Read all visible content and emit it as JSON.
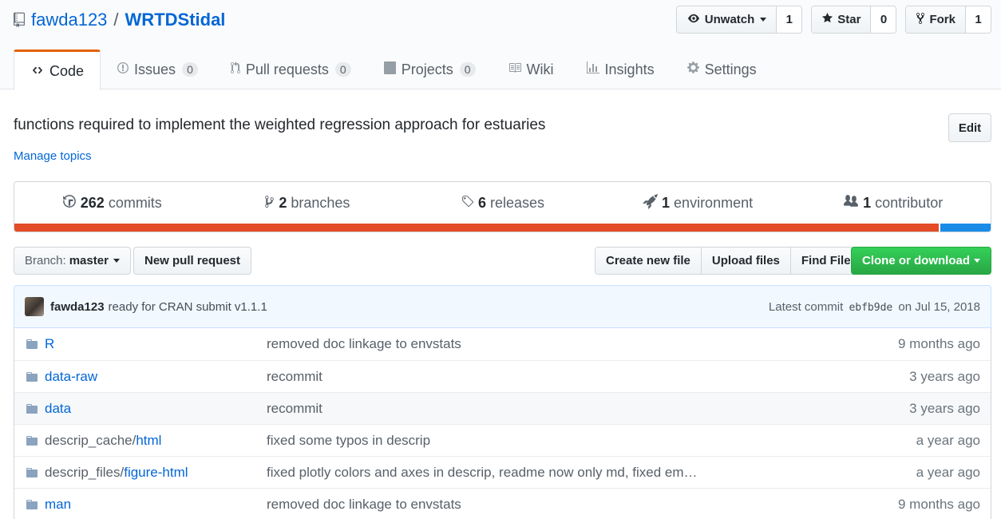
{
  "repo": {
    "owner": "fawda123",
    "separator": "/",
    "name": "WRTDStidal"
  },
  "actions": {
    "watch": {
      "label": "Unwatch",
      "count": "1"
    },
    "star": {
      "label": "Star",
      "count": "0"
    },
    "fork": {
      "label": "Fork",
      "count": "1"
    }
  },
  "tabs": [
    {
      "label": "Code",
      "icon": "code-icon",
      "selected": true
    },
    {
      "label": "Issues",
      "count": "0",
      "icon": "issue-icon"
    },
    {
      "label": "Pull requests",
      "count": "0",
      "icon": "pull-request-icon"
    },
    {
      "label": "Projects",
      "count": "0",
      "icon": "project-icon"
    },
    {
      "label": "Wiki",
      "icon": "book-icon"
    },
    {
      "label": "Insights",
      "icon": "graph-icon"
    },
    {
      "label": "Settings",
      "icon": "gear-icon"
    }
  ],
  "description": "functions required to implement the weighted regression approach for estuaries",
  "edit_label": "Edit",
  "manage_topics": "Manage topics",
  "summary": {
    "commits": {
      "count": "262",
      "label": "commits"
    },
    "branches": {
      "count": "2",
      "label": "branches"
    },
    "releases": {
      "count": "6",
      "label": "releases"
    },
    "environments": {
      "count": "1",
      "label": "environment"
    },
    "contributors": {
      "count": "1",
      "label": "contributor"
    }
  },
  "language_bar": [
    {
      "color": "#e34c26",
      "fraction": 0.947
    },
    {
      "color": "#198ce7",
      "fraction": 0.053
    }
  ],
  "file_nav": {
    "branch_prefix": "Branch:",
    "branch": "master",
    "new_pr": "New pull request",
    "create_file": "Create new file",
    "upload_files": "Upload files",
    "find_file": "Find File",
    "clone": "Clone or download"
  },
  "latest_commit": {
    "author": "fawda123",
    "message": "ready for CRAN submit v1.1.1",
    "prefix": "Latest commit",
    "sha": "ebfb9de",
    "date": "on Jul 15, 2018"
  },
  "files": [
    {
      "dir": "",
      "name": "R",
      "message": "removed doc linkage to envstats",
      "age": "9 months ago"
    },
    {
      "dir": "",
      "name": "data-raw",
      "message": "recommit",
      "age": "3 years ago"
    },
    {
      "dir": "",
      "name": "data",
      "message": "recommit",
      "age": "3 years ago"
    },
    {
      "dir": "descrip_cache/",
      "name": "html",
      "message": "fixed some typos in descrip",
      "age": "a year ago"
    },
    {
      "dir": "descrip_files/",
      "name": "figure-html",
      "message": "fixed plotly colors and axes in descrip, readme now only md, fixed em…",
      "age": "a year ago"
    },
    {
      "dir": "",
      "name": "man",
      "message": "removed doc linkage to envstats",
      "age": "9 months ago"
    }
  ]
}
